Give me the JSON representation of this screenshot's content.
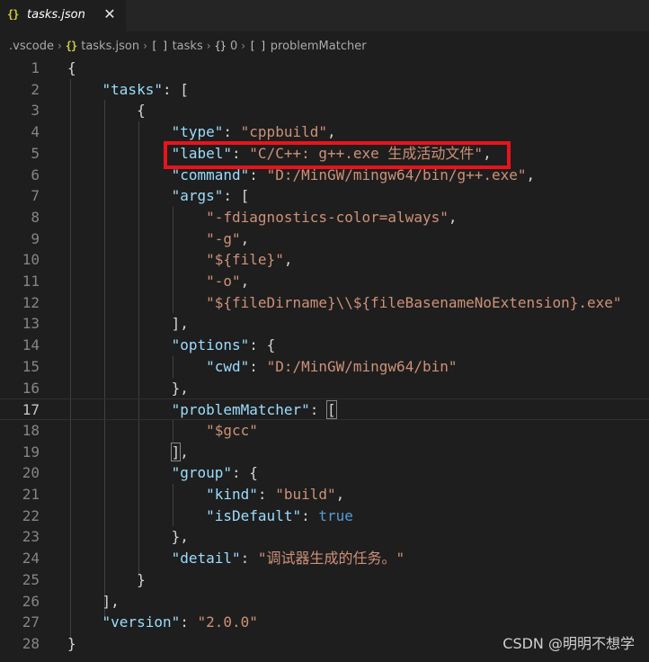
{
  "tab": {
    "icon": "{}",
    "icon_name": "json-braces-icon",
    "title": "tasks.json",
    "close": "✕"
  },
  "breadcrumb": {
    "items": [
      {
        "icon": "",
        "label": ".vscode"
      },
      {
        "icon": "{}",
        "label": "tasks.json"
      },
      {
        "icon": "[ ]",
        "label": "tasks"
      },
      {
        "icon": "{}",
        "label": "0"
      },
      {
        "icon": "[ ]",
        "label": "problemMatcher"
      }
    ],
    "separator": "›"
  },
  "editor": {
    "current_line": 17,
    "lines": [
      {
        "n": "1",
        "tokens": [
          {
            "t": "p",
            "v": "{"
          }
        ]
      },
      {
        "n": "2",
        "tokens": [
          {
            "t": "p",
            "v": "    "
          },
          {
            "t": "k",
            "v": "\"tasks\""
          },
          {
            "t": "p",
            "v": ": ["
          }
        ]
      },
      {
        "n": "3",
        "tokens": [
          {
            "t": "p",
            "v": "        {"
          }
        ]
      },
      {
        "n": "4",
        "tokens": [
          {
            "t": "p",
            "v": "            "
          },
          {
            "t": "k",
            "v": "\"type\""
          },
          {
            "t": "p",
            "v": ": "
          },
          {
            "t": "s",
            "v": "\"cppbuild\""
          },
          {
            "t": "p",
            "v": ","
          }
        ]
      },
      {
        "n": "5",
        "tokens": [
          {
            "t": "p",
            "v": "            "
          },
          {
            "t": "k",
            "v": "\"label\""
          },
          {
            "t": "p",
            "v": ": "
          },
          {
            "t": "s",
            "v": "\"C/C++: g++.exe 生成活动文件\""
          },
          {
            "t": "p",
            "v": ","
          }
        ]
      },
      {
        "n": "6",
        "tokens": [
          {
            "t": "p",
            "v": "            "
          },
          {
            "t": "k",
            "v": "\"command\""
          },
          {
            "t": "p",
            "v": ": "
          },
          {
            "t": "s",
            "v": "\"D:/MinGW/mingw64/bin/g++.exe\""
          },
          {
            "t": "p",
            "v": ","
          }
        ]
      },
      {
        "n": "7",
        "tokens": [
          {
            "t": "p",
            "v": "            "
          },
          {
            "t": "k",
            "v": "\"args\""
          },
          {
            "t": "p",
            "v": ": ["
          }
        ]
      },
      {
        "n": "8",
        "tokens": [
          {
            "t": "p",
            "v": "                "
          },
          {
            "t": "s",
            "v": "\"-fdiagnostics-color=always\""
          },
          {
            "t": "p",
            "v": ","
          }
        ]
      },
      {
        "n": "9",
        "tokens": [
          {
            "t": "p",
            "v": "                "
          },
          {
            "t": "s",
            "v": "\"-g\""
          },
          {
            "t": "p",
            "v": ","
          }
        ]
      },
      {
        "n": "10",
        "tokens": [
          {
            "t": "p",
            "v": "                "
          },
          {
            "t": "s",
            "v": "\"${file}\""
          },
          {
            "t": "p",
            "v": ","
          }
        ]
      },
      {
        "n": "11",
        "tokens": [
          {
            "t": "p",
            "v": "                "
          },
          {
            "t": "s",
            "v": "\"-o\""
          },
          {
            "t": "p",
            "v": ","
          }
        ]
      },
      {
        "n": "12",
        "tokens": [
          {
            "t": "p",
            "v": "                "
          },
          {
            "t": "s",
            "v": "\"${fileDirname}\\\\${fileBasenameNoExtension}.exe\""
          }
        ]
      },
      {
        "n": "13",
        "tokens": [
          {
            "t": "p",
            "v": "            ],"
          }
        ]
      },
      {
        "n": "14",
        "tokens": [
          {
            "t": "p",
            "v": "            "
          },
          {
            "t": "k",
            "v": "\"options\""
          },
          {
            "t": "p",
            "v": ": {"
          }
        ]
      },
      {
        "n": "15",
        "tokens": [
          {
            "t": "p",
            "v": "                "
          },
          {
            "t": "k",
            "v": "\"cwd\""
          },
          {
            "t": "p",
            "v": ": "
          },
          {
            "t": "s",
            "v": "\"D:/MinGW/mingw64/bin\""
          }
        ]
      },
      {
        "n": "16",
        "tokens": [
          {
            "t": "p",
            "v": "            },"
          }
        ]
      },
      {
        "n": "17",
        "tokens": [
          {
            "t": "p",
            "v": "            "
          },
          {
            "t": "k",
            "v": "\"problemMatcher\""
          },
          {
            "t": "p",
            "v": ": "
          },
          {
            "t": "bm",
            "v": "["
          }
        ]
      },
      {
        "n": "18",
        "tokens": [
          {
            "t": "p",
            "v": "                "
          },
          {
            "t": "s",
            "v": "\"$gcc\""
          }
        ]
      },
      {
        "n": "19",
        "tokens": [
          {
            "t": "p",
            "v": "            "
          },
          {
            "t": "bm",
            "v": "]"
          },
          {
            "t": "p",
            "v": ","
          }
        ]
      },
      {
        "n": "20",
        "tokens": [
          {
            "t": "p",
            "v": "            "
          },
          {
            "t": "k",
            "v": "\"group\""
          },
          {
            "t": "p",
            "v": ": {"
          }
        ]
      },
      {
        "n": "21",
        "tokens": [
          {
            "t": "p",
            "v": "                "
          },
          {
            "t": "k",
            "v": "\"kind\""
          },
          {
            "t": "p",
            "v": ": "
          },
          {
            "t": "s",
            "v": "\"build\""
          },
          {
            "t": "p",
            "v": ","
          }
        ]
      },
      {
        "n": "22",
        "tokens": [
          {
            "t": "p",
            "v": "                "
          },
          {
            "t": "k",
            "v": "\"isDefault\""
          },
          {
            "t": "p",
            "v": ": "
          },
          {
            "t": "b",
            "v": "true"
          }
        ]
      },
      {
        "n": "23",
        "tokens": [
          {
            "t": "p",
            "v": "            },"
          }
        ]
      },
      {
        "n": "24",
        "tokens": [
          {
            "t": "p",
            "v": "            "
          },
          {
            "t": "k",
            "v": "\"detail\""
          },
          {
            "t": "p",
            "v": ": "
          },
          {
            "t": "s",
            "v": "\"调试器生成的任务。\""
          }
        ]
      },
      {
        "n": "25",
        "tokens": [
          {
            "t": "p",
            "v": "        }"
          }
        ]
      },
      {
        "n": "26",
        "tokens": [
          {
            "t": "p",
            "v": "    ],"
          }
        ]
      },
      {
        "n": "27",
        "tokens": [
          {
            "t": "p",
            "v": "    "
          },
          {
            "t": "k",
            "v": "\"version\""
          },
          {
            "t": "p",
            "v": ": "
          },
          {
            "t": "s",
            "v": "\"2.0.0\""
          }
        ]
      },
      {
        "n": "28",
        "tokens": [
          {
            "t": "p",
            "v": "}"
          }
        ]
      }
    ]
  },
  "annotation": {
    "highlighted_line": 5,
    "color": "#e8141c"
  },
  "watermark": "CSDN @明明不想学",
  "colors": {
    "background": "#1e1e1e",
    "key": "#9cdcfe",
    "string": "#ce9178",
    "boolean": "#569cd6",
    "punctuation": "#d4d4d4",
    "line_number": "#858585"
  }
}
